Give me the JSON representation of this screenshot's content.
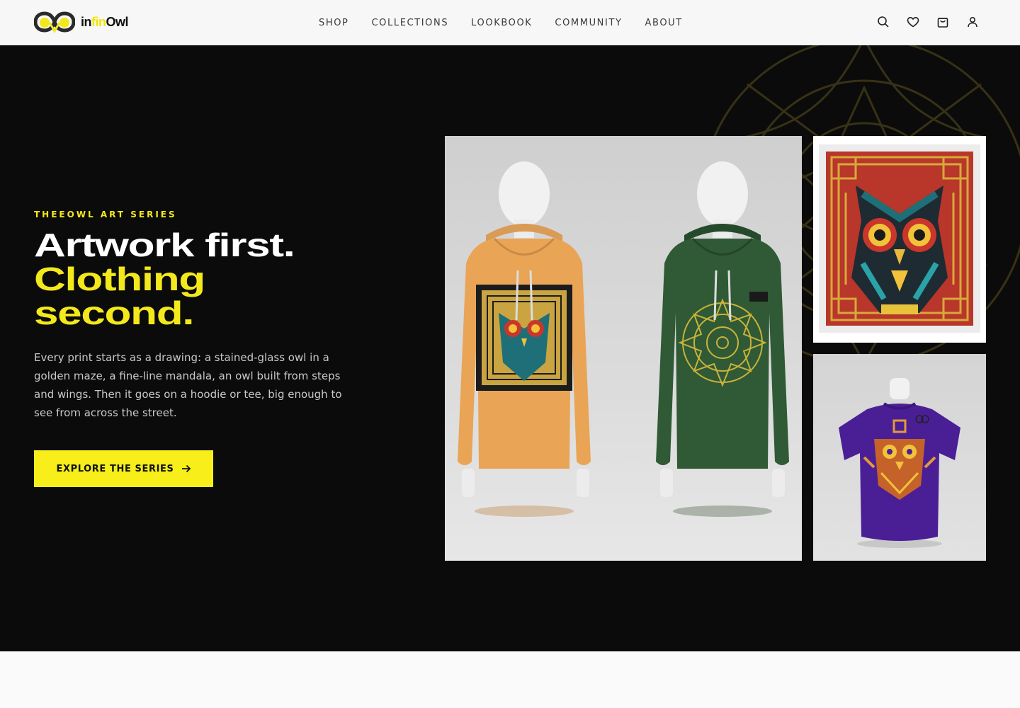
{
  "brand": {
    "prefix": "in",
    "middle": "fin",
    "suffix": "Owl",
    "accent": "#f3e81c"
  },
  "nav": {
    "items": [
      "SHOP",
      "COLLECTIONS",
      "LOOKBOOK",
      "COMMUNITY",
      "ABOUT"
    ]
  },
  "header_icons": [
    "search-icon",
    "heart-icon",
    "bag-icon",
    "user-icon"
  ],
  "hero": {
    "eyebrow": "THEEOWL ART SERIES",
    "headline_line1": "Artwork first.",
    "headline_line2": "Clothing",
    "headline_line3": "second.",
    "description": "Every print starts as a drawing: a stained-glass owl in a golden maze, a fine-line mandala, an owl built from steps and wings. Then it goes on a hoodie or tee, big enough to see from across the street.",
    "cta_label": "EXPLORE THE SERIES",
    "background": "#0b0b0b"
  },
  "images": {
    "main": "two-hoodies-on-mannequins",
    "art": "stained-glass-owl-artwork",
    "tee": "purple-owl-tshirt"
  },
  "colors": {
    "hoodie_orange": "#e9a456",
    "hoodie_green": "#2f5a35",
    "tee_purple": "#4a1f96",
    "art_red": "#b8362a",
    "art_gold": "#d8a93a",
    "art_teal": "#1f6f78"
  }
}
